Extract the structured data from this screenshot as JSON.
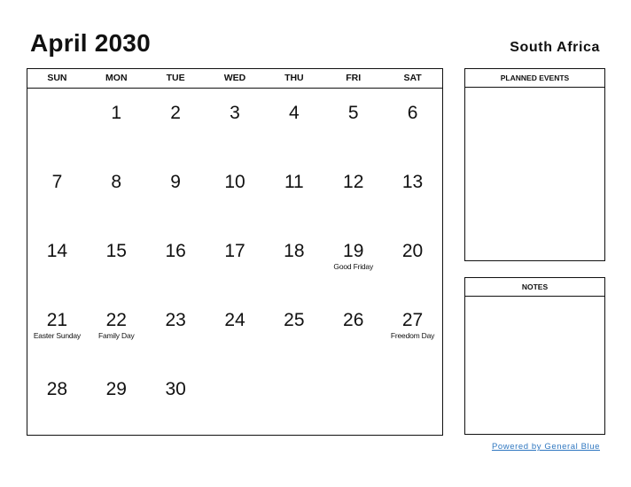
{
  "header": {
    "title": "April 2030",
    "country": "South Africa"
  },
  "calendar": {
    "weekdays": [
      "SUN",
      "MON",
      "TUE",
      "WED",
      "THU",
      "FRI",
      "SAT"
    ],
    "cells": [
      {
        "day": "",
        "holiday": ""
      },
      {
        "day": "1",
        "holiday": ""
      },
      {
        "day": "2",
        "holiday": ""
      },
      {
        "day": "3",
        "holiday": ""
      },
      {
        "day": "4",
        "holiday": ""
      },
      {
        "day": "5",
        "holiday": ""
      },
      {
        "day": "6",
        "holiday": ""
      },
      {
        "day": "7",
        "holiday": ""
      },
      {
        "day": "8",
        "holiday": ""
      },
      {
        "day": "9",
        "holiday": ""
      },
      {
        "day": "10",
        "holiday": ""
      },
      {
        "day": "11",
        "holiday": ""
      },
      {
        "day": "12",
        "holiday": ""
      },
      {
        "day": "13",
        "holiday": ""
      },
      {
        "day": "14",
        "holiday": ""
      },
      {
        "day": "15",
        "holiday": ""
      },
      {
        "day": "16",
        "holiday": ""
      },
      {
        "day": "17",
        "holiday": ""
      },
      {
        "day": "18",
        "holiday": ""
      },
      {
        "day": "19",
        "holiday": "Good Friday"
      },
      {
        "day": "20",
        "holiday": ""
      },
      {
        "day": "21",
        "holiday": "Easter Sunday"
      },
      {
        "day": "22",
        "holiday": "Family Day"
      },
      {
        "day": "23",
        "holiday": ""
      },
      {
        "day": "24",
        "holiday": ""
      },
      {
        "day": "25",
        "holiday": ""
      },
      {
        "day": "26",
        "holiday": ""
      },
      {
        "day": "27",
        "holiday": "Freedom Day"
      },
      {
        "day": "28",
        "holiday": ""
      },
      {
        "day": "29",
        "holiday": ""
      },
      {
        "day": "30",
        "holiday": ""
      },
      {
        "day": "",
        "holiday": ""
      },
      {
        "day": "",
        "holiday": ""
      },
      {
        "day": "",
        "holiday": ""
      },
      {
        "day": "",
        "holiday": ""
      }
    ]
  },
  "panels": {
    "events_title": "PLANNED EVENTS",
    "notes_title": "NOTES"
  },
  "footer": {
    "link_text": "Powered by General Blue",
    "link_color": "#2f77c0"
  }
}
